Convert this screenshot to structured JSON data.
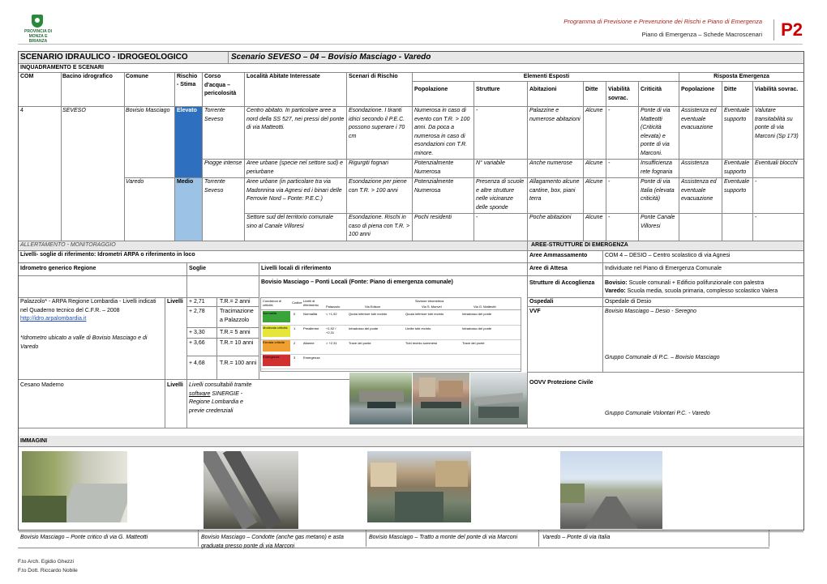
{
  "header": {
    "logo_text": "PROVINCIA DI MONZA E BRIANZA",
    "line1": "Programma di Previsione e Prevenzione dei Rischi e Piano di Emergenza",
    "line2": "Piano di Emergenza – Schede Macroscenari",
    "code": "P2"
  },
  "title": {
    "left": "SCENARIO IDRAULICO - IDROGEOLOGICO",
    "right": "Scenario SEVESO – 04 – Bovisio Masciago - Varedo"
  },
  "section_inq": "INQUADRAMENTO E SCENARI",
  "cols": {
    "com": "COM",
    "bacino": "Bacino idrografico",
    "comune": "Comune",
    "rischio": "Rischio",
    "stima": "- Stima",
    "corso": "Corso d'acqua – pericolosità",
    "localita": "Località Abitate Interessate",
    "scenari": "Scenari di Rischio",
    "esposti": "Elementi Esposti",
    "risposta": "Risposta Emergenza",
    "popolazione": "Popolazione",
    "strutture": "Strutture",
    "abitazioni": "Abitazioni",
    "ditte": "Ditte",
    "viabilita": "Viabilità sovrac.",
    "criticita": "Criticità",
    "popolazione2": "Popolazione",
    "ditte2": "Ditte",
    "viabilita2": "Viabilità sovrac."
  },
  "rows": [
    {
      "com": "4",
      "bacino": "SEVESO",
      "comune": "Bovisio Masciago",
      "rischio": "Elevato",
      "corso": "Torrente Seveso",
      "localita": "Centro abitato. In particolare aree a nord della SS 527, nei pressi del ponte di via Matteotti.",
      "scenari": "Esondazione. I tiranti idrici secondo il P.E.C. possono superare i 70 cm",
      "popolazione": "Numerosa in caso di evento con T.R. > 100 anni. Da poca a numerosa in caso di esondazioni con T.R. minore.",
      "strutture": "-",
      "abitazioni": "Palazzine e numerose abitazioni",
      "ditte": "Alcune",
      "viabilita": "-",
      "criticita": "Ponte di via Matteotti (Criticità elevata) e ponte di via Marconi.",
      "pop2": "Assistenza ed eventuale evacuazione",
      "ditte2": "Eventuale supporto",
      "viab2": "Valutare transitabilità su ponte di via Marconi (Sp 173)"
    },
    {
      "corso": "Piogge intense",
      "localita": "Aree urbane (specie nel settore sud) e periurbane",
      "scenari": "Rigurgiti fognari",
      "popolazione": "Potenzialmente Numerosa",
      "strutture": "N° variabile",
      "abitazioni": "Anche numerose",
      "ditte": "Alcune",
      "viabilita": "-",
      "criticita": "Insufficienza rete fognaria",
      "pop2": "Assistenza",
      "ditte2": "Eventuale supporto",
      "viab2": "Eventuali blocchi"
    },
    {
      "comune": "Varedo",
      "rischio": "Medio",
      "corso": "Torrente Seveso",
      "localita": "Aree urbane (in particolare tra via Madonnina via Agnesi ed i binari delle Ferrovie Nord – Fonte: P.E.C.)",
      "scenari": "Esondazione per piene con T.R. > 100 anni",
      "popolazione": "Potenzialmente Numerosa",
      "strutture": "Presenza di scuole e altre strutture nelle vicinanze delle sponde",
      "abitazioni": "Allagamento alcune cantine, box, piani terra",
      "ditte": "Alcune",
      "viabilita": "-",
      "criticita": "Ponte di via Italia (elevata criticità)",
      "pop2": "Assistenza ed eventuale evacuazione",
      "ditte2": "Eventuale supporto",
      "viab2": "-"
    },
    {
      "localita": "Settore sud del territorio comunale sino al Canale Villoresi",
      "scenari": "Esondazione. Rischi in caso di piena con T.R. > 100 anni",
      "popolazione": "Pochi residenti",
      "strutture": "-",
      "abitazioni": "Poche abitazioni",
      "ditte": "Alcune",
      "viabilita": "-",
      "criticita": "Ponte Canale Villoresi",
      "viab2": "-"
    }
  ],
  "allert": {
    "section": "ALLERTAMENTO - MONITORAGGIO",
    "livelli_title": "Livelli- soglie di riferimento: Idrometri ARPA o riferimento in loco",
    "idro_generico": "Idrometro generico Regione",
    "soglie": "Soglie",
    "livelli_locali": "Livelli locali di riferimento",
    "ponti_locali": "Bovisio Masciago – Ponti Locali (Fonte: Piano di emergenza comunale)",
    "palazzolo": "Palazzolo* - ARPA Regione Lombardia - Livelli indicati nel Quaderno tecnico del C.F.R. – 2008",
    "link": "http://idro.arpalombardia.it",
    "livelli": "Livelli",
    "note": "*Idrometro ubicato a valle di Bovisio Masciago e di Varedo",
    "soglie_rows": [
      {
        "v": "+ 2,71",
        "t": "T.R.= 2 anni"
      },
      {
        "v": "+ 2,78",
        "t": "Tracimazione a Palazzolo"
      },
      {
        "v": "+ 3,30",
        "t": "T.R.= 5 anni"
      },
      {
        "v": "+ 3,66",
        "t": "T.R.= 10 anni"
      },
      {
        "v": "+ 4,68",
        "t": "T.R.= 100 anni"
      }
    ],
    "cesano": "Cesano Maderno",
    "cesano_livelli": "Livelli",
    "consultabili_pre": "Livelli consultabili tramite ",
    "consultabili_link": "software",
    "consultabili_post": " SINERGIE - Regione Lombardia e previe credenziali"
  },
  "table_img": {
    "h_cond": "Condizioni di criticità",
    "h_cod": "Codice",
    "h_liv": "Livelli di riferimento",
    "h_idro": "Palazzolo",
    "h_sez": "Sezione idrometrica",
    "h_edison": "Via Edison",
    "h_monvel": "Via S. Monvel",
    "h_matteotti": "Via G. Matteotti",
    "rows": [
      {
        "cond": "Normalità",
        "cod": "0",
        "liv": "Normalità",
        "idro": "< +1,92",
        "a": "Quota inferiore tubi recinto",
        "b": "Quota inferiore tubi recinto",
        "c": "Intradosso del ponte"
      },
      {
        "cond": "Moderata criticità",
        "cod": "1",
        "liv": "Preallerme",
        "idro": "+1,92 / +2,31",
        "a": "Intradosso del ponte",
        "b": "Limite tubi recinto",
        "c": "Intradosso del ponte"
      },
      {
        "cond": "Elevata criticità",
        "cod": "2",
        "liv": "Allarme",
        "idro": "> +2,31",
        "a": "Trave del ponte",
        "b": "Tubi recinto sommersi",
        "c": "Trave del ponte"
      },
      {
        "cond": "Emergenza",
        "cod": "3",
        "liv": "Emergenza",
        "idro": "",
        "a": "",
        "b": "",
        "c": ""
      }
    ]
  },
  "aree": {
    "section": "AREE-STRUTTURE DI EMERGENZA",
    "ammassamento": "Aree Ammassamento",
    "ammassamento_v": "COM 4 – DESIO – Centro scolastico di via Agnesi",
    "attesa": "Aree di Attesa",
    "attesa_v": "Individuate nel Piano di Emergenza Comunale",
    "accoglienza": "Strutture di Accoglienza",
    "acc1_k": "Bovisio:",
    "acc1_v": " Scuole comunali + Edificio polifunzionale con palestra",
    "acc2_k": "Varedo:",
    "acc2_v": " Scuola media, scuola primaria, complesso scolastico Valera",
    "ospedali": "Ospedali",
    "ospedali_v": "Ospedale di Desio",
    "vvf": "VVF",
    "vvf_v": "Bovisio Masciago – Desio - Seregno",
    "pc": "Gruppo Comunale di P.C. – Bovisio Masciago",
    "oovv": "OOVV Protezione Civile",
    "volontari": "Gruppo Comunale Volontari P.C. - Varedo"
  },
  "immagini": {
    "section": "IMMAGINI",
    "cap1": "Bovisio Masciago – Ponte critico di via G. Matteotti",
    "cap2": "Bovisio Masciago – Condotte (anche gas metano) e asta graduata presso ponte di via Marconi",
    "cap3": "Bovisio Masciago – Tratto a monte del ponte di via Marconi",
    "cap4": "Varedo – Ponte di via Italia"
  },
  "footer": {
    "sig1": "F.to Arch. Egidio Ghezzi",
    "sig2": "F.to Dott. Riccardo Nobile"
  },
  "colors": {
    "elevato": "#2e6fc0",
    "medio": "#9cc3e6",
    "normal": "#3aa33a",
    "moderata": "#e6e63a",
    "elevata": "#f0a030",
    "emergenza": "#d03030"
  }
}
